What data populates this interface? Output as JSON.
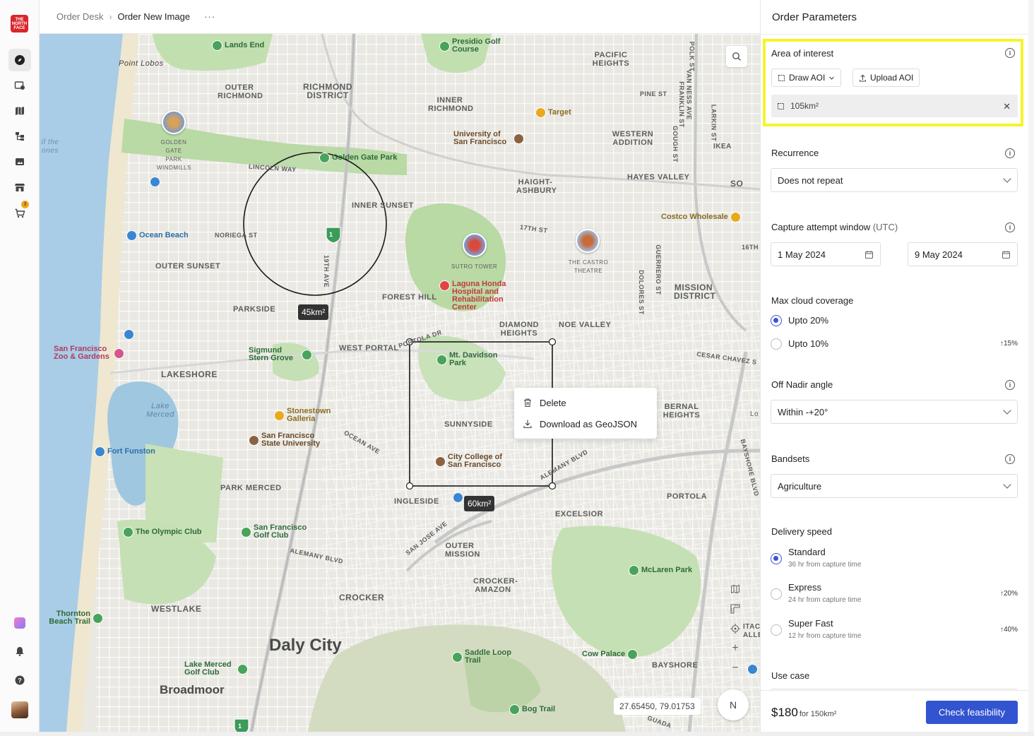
{
  "app": {
    "logo_text": "THE NORTH FACE"
  },
  "rail": {
    "items": [
      {
        "name": "compass-icon",
        "active": true
      },
      {
        "name": "image-order-icon"
      },
      {
        "name": "map-icon"
      },
      {
        "name": "workflow-icon"
      },
      {
        "name": "gallery-icon"
      },
      {
        "name": "store-icon"
      },
      {
        "name": "cart-icon",
        "badge": "3"
      }
    ],
    "bottom": [
      "ai-assistant-icon",
      "bell-icon",
      "help-icon",
      "avatar"
    ]
  },
  "breadcrumb": {
    "root": "Order Desk",
    "separator": "›",
    "current": "Order New Image",
    "more": "···"
  },
  "map": {
    "labels": {
      "daly_city": "Daly City",
      "broadmoor": "Broadmoor",
      "richmond_district": "RICHMOND DISTRICT",
      "outer_richmond": "OUTER RICHMOND",
      "inner_richmond": "INNER RICHMOND",
      "pacific_heights": "PACIFIC HEIGHTS",
      "western_addition": "WESTERN ADDITION",
      "hayes_valley": "HAYES VALLEY",
      "haight_ashbury": "HAIGHT-ASHBURY",
      "inner_sunset": "INNER SUNSET",
      "outer_sunset": "OUTER SUNSET",
      "parkside": "PARKSIDE",
      "forest_hill": "FOREST HILL",
      "diamond_heights": "DIAMOND HEIGHTS",
      "noe_valley": "NOE VALLEY",
      "mission_district": "MISSION DISTRICT",
      "west_portal": "WEST PORTAL",
      "lakeshore": "LAKESHORE",
      "sunnyside": "SUNNYSIDE",
      "bernal_heights": "BERNAL HEIGHTS",
      "park_merced": "PARK MERCED",
      "ingleside": "INGLESIDE",
      "excelsior": "EXCELSIOR",
      "portola": "PORTOLA",
      "outer_mission": "OUTER MISSION",
      "crocker_amazon": "CROCKER-AMAZON",
      "crocker": "CROCKER",
      "westlake": "WESTLAKE",
      "bayshore": "BAYSHORE",
      "point_lobos": "Point Lobos",
      "lake_merced": "Lake Merced",
      "lincoln_way": "LINCOLN WAY",
      "noriega_st": "NORIEGA ST",
      "ave_19th": "19TH AVE",
      "st_17th": "17TH ST",
      "pine_st": "PINE ST",
      "ocean_ave": "OCEAN AVE",
      "alemany_blvd": "ALEMANY BLVD",
      "alemany_blvd_2": "ALEMANY BLVD",
      "san_jose_ave": "SAN JOSE AVE",
      "cesar_chavez": "CESAR CHAVEZ S",
      "portola_dr": "PORTOLA DR",
      "polk_st": "POLK ST",
      "van_ness": "VAN NESS AVE",
      "franklin_st": "FRANKLIN ST",
      "gough_st": "GOUGH ST",
      "larkin_st": "LARKIN ST",
      "guerrero_st": "GUERRERO ST",
      "dolores_st": "DOLORES ST",
      "bayshore_blvd": "BAYSHORE BLVD",
      "st_16th": "16TH",
      "sutro_tower": "SUTRO TOWER",
      "castro_theatre": "THE CASTRO THEATRE",
      "windmill": "GOLDEN GATE PARK WINDMILLS",
      "ikea": "IKEA",
      "so": "SO",
      "guada": "GUADA",
      "itac": "ITAC",
      "alle": "ALLE",
      "lo": "Lo",
      "the_ones": "if the ones"
    },
    "pois": {
      "lands_end": "Lands End",
      "presidio": "Presidio Golf Course",
      "target": "Target",
      "usf": "University of San Francisco",
      "golden_gate_park": "Golden Gate Park",
      "ocean_beach": "Ocean Beach",
      "costco": "Costco Wholesale",
      "laguna_honda": "Laguna Honda Hospital and Rehabilitation Center",
      "sf_zoo": "San Francisco Zoo & Gardens",
      "sigmund_stern": "Sigmund Stern Grove",
      "mt_davidson": "Mt. Davidson Park",
      "stonestown": "Stonestown Galleria",
      "sfsu": "San Francisco State University",
      "fort_funston": "Fort Funston",
      "city_college": "City College of San Francisco",
      "olympic_club": "The Olympic Club",
      "sf_golf_club": "San Francisco Golf Club",
      "mclaren_park": "McLaren Park",
      "thornton_beach": "Thornton Beach Trail",
      "lake_merced_golf": "Lake Merced Golf Club",
      "saddle_loop": "Saddle Loop Trail",
      "cow_palace": "Cow Palace",
      "bog_trail": "Bog Trail"
    },
    "aoi_circle_label": "45km²",
    "aoi_rect_label": "60km²",
    "route_badge": "1",
    "coords": "27.65450, 79.01753",
    "compass": "N",
    "controls": [
      "map-layers-icon",
      "ruler-icon",
      "locate-icon",
      "zoom-in-icon",
      "zoom-out-icon"
    ]
  },
  "context_menu": {
    "delete": "Delete",
    "download": "Download as GeoJSON"
  },
  "panel": {
    "title": "Order Parameters",
    "aoi": {
      "label": "Area of interest",
      "draw_label": "Draw AOI",
      "upload_label": "Upload AOI",
      "item_label": "105km²",
      "highlight_color": "#f7f32d"
    },
    "recurrence": {
      "label": "Recurrence",
      "value": "Does not repeat"
    },
    "capture": {
      "label": "Capture attempt window",
      "tz": "(UTC)",
      "start": "1 May 2024",
      "end": "9 May 2024"
    },
    "cloud": {
      "label": "Max cloud coverage",
      "options": [
        {
          "label": "Upto 20%",
          "selected": true,
          "extra": ""
        },
        {
          "label": "Upto 10%",
          "selected": false,
          "extra": "↑15%"
        }
      ]
    },
    "nadir": {
      "label": "Off Nadir angle",
      "value": "Within -+20°"
    },
    "bandsets": {
      "label": "Bandsets",
      "value": "Agriculture"
    },
    "delivery": {
      "label": "Delivery speed",
      "options": [
        {
          "label": "Standard",
          "sub": "36 hr from capture time",
          "selected": true,
          "extra": ""
        },
        {
          "label": "Express",
          "sub": "24 hr from capture time",
          "selected": false,
          "extra": "↑20%"
        },
        {
          "label": "Super Fast",
          "sub": "12 hr from capture time",
          "selected": false,
          "extra": "↑40%"
        }
      ]
    },
    "use_case": {
      "label": "Use case"
    },
    "footer": {
      "price": "$180",
      "price_sub": "for 150km²",
      "cta": "Check feasibility"
    },
    "accent_color": "#3354d1"
  }
}
